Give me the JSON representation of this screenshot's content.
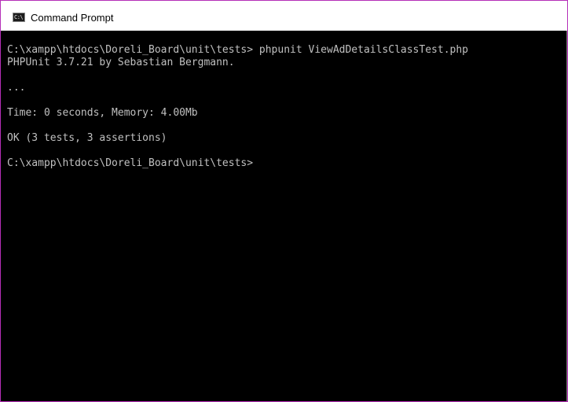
{
  "window": {
    "title": "Command Prompt",
    "icon": "command-prompt-icon",
    "icon_glyph": "C:\\",
    "border_color": "#b52fb8"
  },
  "console": {
    "background": "#000000",
    "text_color": "#c0c0c0",
    "lines": [
      "C:\\xampp\\htdocs\\Doreli_Board\\unit\\tests> phpunit ViewAdDetailsClassTest.php",
      "PHPUnit 3.7.21 by Sebastian Bergmann.",
      "",
      "...",
      "",
      "Time: 0 seconds, Memory: 4.00Mb",
      "",
      "OK (3 tests, 3 assertions)",
      "",
      "C:\\xampp\\htdocs\\Doreli_Board\\unit\\tests>"
    ]
  }
}
